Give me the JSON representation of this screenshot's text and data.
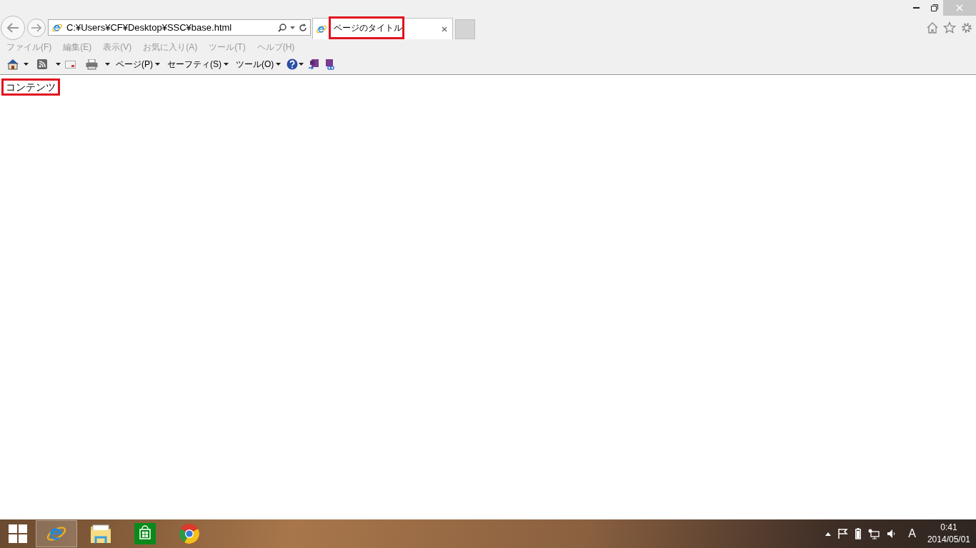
{
  "address_bar": {
    "value": "C:¥Users¥CF¥Desktop¥SSC¥base.html"
  },
  "tabs": [
    {
      "title": "ページのタイトル",
      "selected": true,
      "highlighted": true
    }
  ],
  "menu_bar": [
    "ファイル(F)",
    "編集(E)",
    "表示(V)",
    "お気に入り(A)",
    "ツール(T)",
    "ヘルプ(H)"
  ],
  "command_bar": {
    "menus": [
      "ページ(P)",
      "セーフティ(S)",
      "ツール(O)"
    ]
  },
  "content": {
    "text": "コンテンツ",
    "highlighted": true
  },
  "taskbar": {
    "apps": [
      {
        "kind": "browser",
        "selected": true
      },
      {
        "kind": "files",
        "selected": false
      },
      {
        "kind": "store",
        "selected": false
      },
      {
        "kind": "globe",
        "selected": false
      }
    ],
    "ime": "A",
    "time": "0:41",
    "date": "2014/05/01"
  }
}
